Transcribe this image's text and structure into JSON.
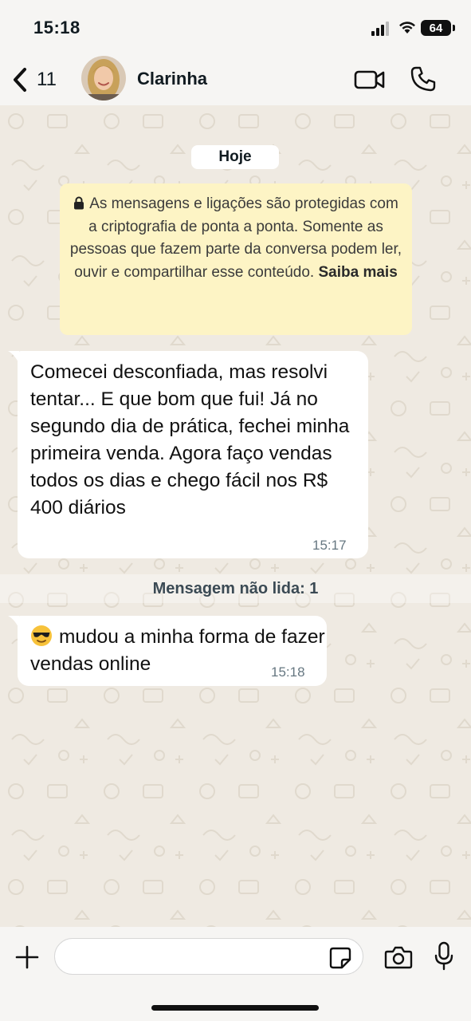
{
  "status_bar": {
    "time": "15:18",
    "battery": "64"
  },
  "header": {
    "back_count": "11",
    "contact_name": "Clarinha"
  },
  "chat": {
    "date_label": "Hoje",
    "encryption_notice": "As mensagens e ligações são protegidas com a criptografia de ponta a ponta. Somente as pessoas que fazem parte da conversa podem ler, ouvir e compartilhar esse conteúdo.",
    "encryption_learn_more": "Saiba mais",
    "messages": [
      {
        "text": "Comecei desconfiada, mas resolvi tentar... E que bom que fui! Já no segundo dia de prática, fechei minha primeira venda. Agora faço vendas todos os dias e chego fácil nos R$ 400 diários",
        "time": "15:17"
      },
      {
        "text": "mudou a minha forma de fazer vendas online",
        "time": "15:18"
      }
    ],
    "unread_divider": "Mensagem não lida: 1"
  },
  "composer": {
    "placeholder": ""
  },
  "colors": {
    "chat_background": "#efeae2",
    "bubble_incoming": "#ffffff",
    "notice_background": "#fdf4c5",
    "timestamp": "#667781"
  },
  "icons": {
    "back": "chevron-left-icon",
    "video": "video-camera-icon",
    "call": "phone-icon",
    "lock": "lock-icon",
    "emoji": "sunglasses-emoji-icon",
    "plus": "plus-icon",
    "sticker": "sticker-icon",
    "camera": "camera-icon",
    "mic": "microphone-icon"
  }
}
